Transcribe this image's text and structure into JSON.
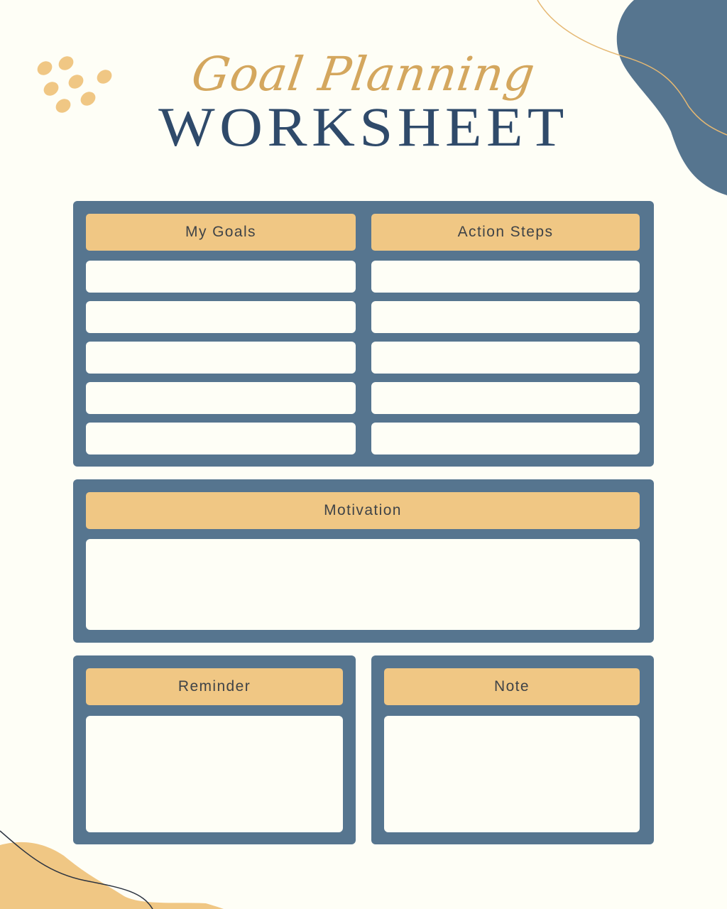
{
  "title": {
    "script": "Goal Planning",
    "main": "WORKSHEET"
  },
  "colors": {
    "background": "#fefef6",
    "panel": "#56758f",
    "header": "#f0c784",
    "title_main": "#2f4a6a",
    "title_script": "#d4a75e",
    "header_text": "#3f4347"
  },
  "goals_panel": {
    "left_header": "My Goals",
    "right_header": "Action Steps",
    "left_rows": [
      "",
      "",
      "",
      "",
      ""
    ],
    "right_rows": [
      "",
      "",
      "",
      "",
      ""
    ]
  },
  "motivation_panel": {
    "header": "Motivation",
    "body": ""
  },
  "reminder_panel": {
    "header": "Reminder",
    "body": ""
  },
  "note_panel": {
    "header": "Note",
    "body": ""
  },
  "decorations": [
    "dots-cluster",
    "blue-blob-top-right",
    "gold-curve-line",
    "gold-blob-bottom-left",
    "dark-curve-line"
  ]
}
